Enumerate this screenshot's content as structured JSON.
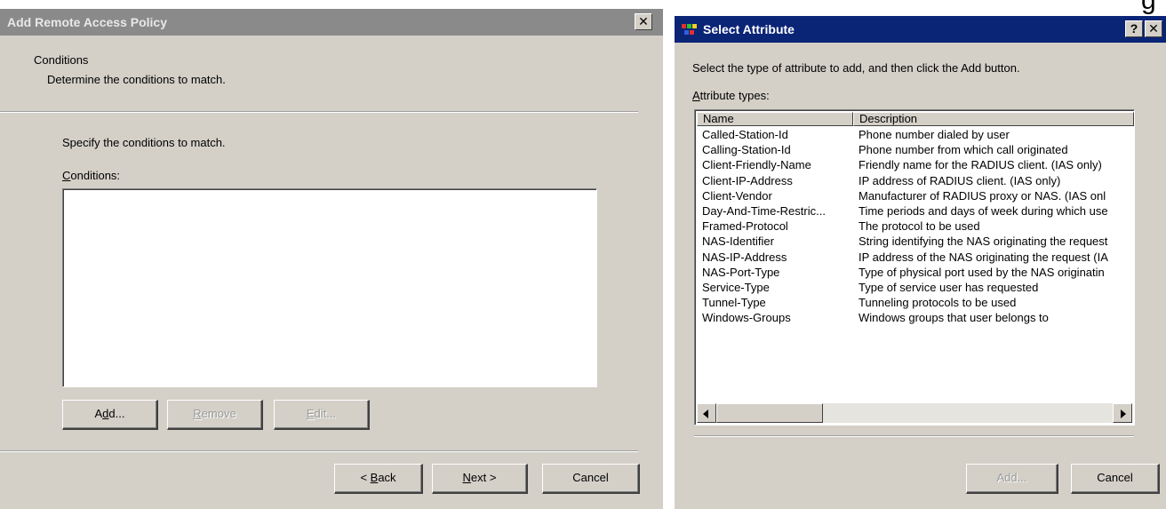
{
  "left_dialog": {
    "title": "Add Remote Access Policy",
    "close_glyph": "✕",
    "header_title": "Conditions",
    "header_subtitle": "Determine the conditions to match.",
    "instruction": "Specify the conditions to match.",
    "conditions_label_first": "C",
    "conditions_label_rest": "onditions:",
    "add_button": {
      "prefix": "A",
      "accel": "d",
      "suffix": "d..."
    },
    "remove_button": {
      "accel": "R",
      "suffix": "emove"
    },
    "edit_button": {
      "accel": "E",
      "suffix": "dit..."
    },
    "back_button": {
      "prefix": "< ",
      "accel": "B",
      "suffix": "ack"
    },
    "next_button": {
      "accel": "N",
      "suffix": "ext >"
    },
    "cancel_button": "Cancel"
  },
  "right_dialog": {
    "title": "Select Attribute",
    "help_glyph": "?",
    "close_glyph": "✕",
    "instruction": "Select the type of attribute to add, and then click the Add button.",
    "list_label_first": "A",
    "list_label_rest": "ttribute types:",
    "columns": {
      "name": "Name",
      "description": "Description"
    },
    "rows": [
      {
        "name": "Called-Station-Id",
        "description": "Phone number dialed by user"
      },
      {
        "name": "Calling-Station-Id",
        "description": "Phone number from which call originated"
      },
      {
        "name": "Client-Friendly-Name",
        "description": "Friendly name for the RADIUS client. (IAS only)"
      },
      {
        "name": "Client-IP-Address",
        "description": "IP address of RADIUS client. (IAS only)"
      },
      {
        "name": "Client-Vendor",
        "description": "Manufacturer of RADIUS proxy or NAS. (IAS onl"
      },
      {
        "name": "Day-And-Time-Restric...",
        "description": "Time periods and days of week during which use"
      },
      {
        "name": "Framed-Protocol",
        "description": "The protocol to be used"
      },
      {
        "name": "NAS-Identifier",
        "description": "String identifying the NAS originating the request"
      },
      {
        "name": "NAS-IP-Address",
        "description": "IP address of the NAS originating the request (IA"
      },
      {
        "name": "NAS-Port-Type",
        "description": "Type of physical port used by the NAS originatin"
      },
      {
        "name": "Service-Type",
        "description": "Type of service user has requested"
      },
      {
        "name": "Tunnel-Type",
        "description": "Tunneling protocols to be used"
      },
      {
        "name": "Windows-Groups",
        "description": "Windows groups that user belongs to"
      }
    ],
    "add_button": "Add...",
    "cancel_button": "Cancel"
  },
  "corner_fragment": "g",
  "colors": {
    "dialog_face": "#d4d0c8",
    "active_title": "#0a2476",
    "inactive_title": "#8a8a8a"
  }
}
